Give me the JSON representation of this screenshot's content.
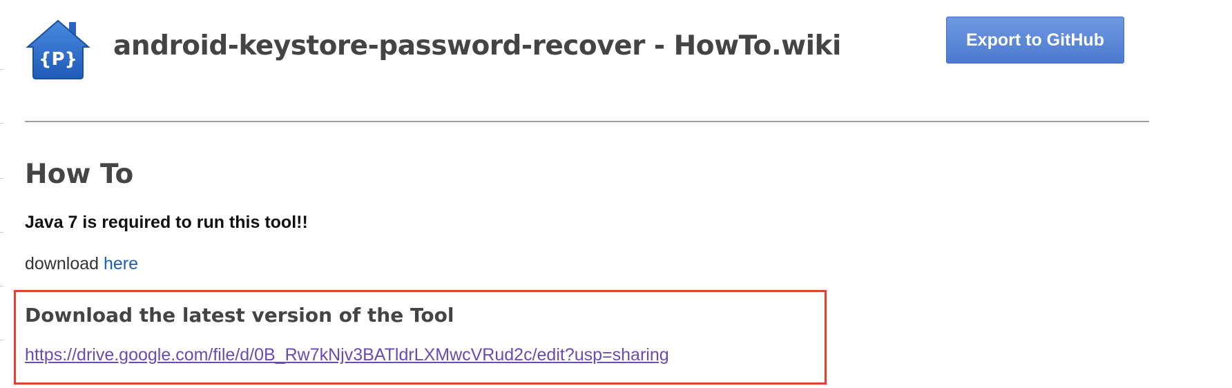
{
  "header": {
    "logo_text": "{P}",
    "title": "android-keystore-password-recover - HowTo.wiki",
    "export_button_label": "Export to GitHub"
  },
  "content": {
    "heading": "How To",
    "requirement": "Java 7 is required to run this tool!!",
    "download_prefix": "download",
    "download_link_label": "here",
    "latest_heading": "Download the latest version of the Tool",
    "latest_link": "https://drive.google.com/file/d/0B_Rw7kNjv3BATldrLXMwcVRud2c/edit?usp=sharing"
  },
  "colors": {
    "accent_button": "#5a86d8",
    "link": "#1a5fb4",
    "visited_link": "#6a4ab5",
    "highlight_border": "#e2412a",
    "logo_blue": "#2f6dc8"
  }
}
